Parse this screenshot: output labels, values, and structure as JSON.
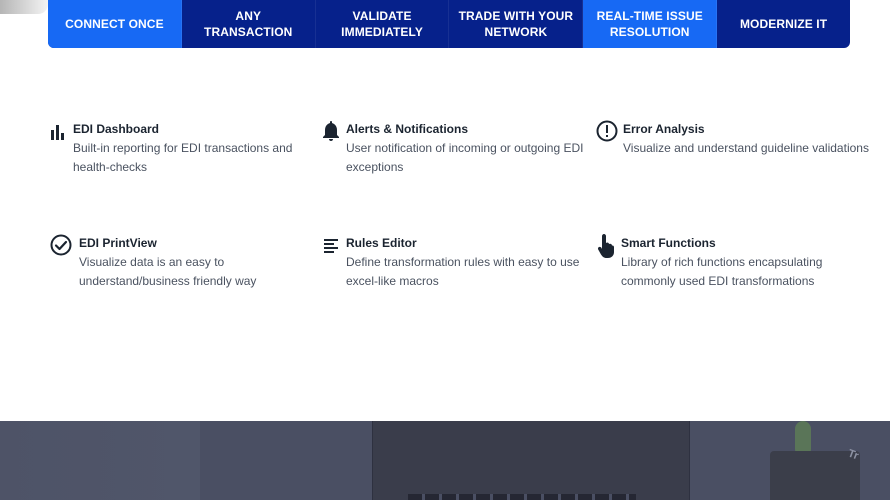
{
  "tabs": [
    {
      "label": "CONNECT ONCE",
      "active": true
    },
    {
      "label": "ANY TRANSACTION",
      "active": false
    },
    {
      "label": "VALIDATE IMMEDIATELY",
      "active": false
    },
    {
      "label": "TRADE WITH YOUR NETWORK",
      "active": false
    },
    {
      "label": "REAL-TIME ISSUE RESOLUTION",
      "active": true
    },
    {
      "label": "MODERNIZE IT",
      "active": false
    }
  ],
  "features": [
    {
      "icon": "bar-chart-icon",
      "title": "EDI Dashboard",
      "desc_line1": "Built-in reporting for EDI transactions and",
      "desc_line2": "health-checks"
    },
    {
      "icon": "bell-icon",
      "title": "Alerts & Notifications",
      "desc_line1": "User notification of incoming or outgoing EDI",
      "desc_line2": "exceptions"
    },
    {
      "icon": "exclamation-circle-icon",
      "title": "Error Analysis",
      "desc_line1": "Visualize and understand guideline validations",
      "desc_line2": ""
    },
    {
      "icon": "check-circle-icon",
      "title": "EDI PrintView",
      "desc_line1": "Visualize data is an easy to",
      "desc_line2": "understand/business friendly way"
    },
    {
      "icon": "text-lines-icon",
      "title": "Rules Editor",
      "desc_line1": "Define transformation rules with easy to use",
      "desc_line2": "excel-like macros"
    },
    {
      "icon": "hand-pointer-icon",
      "title": "Smart Functions",
      "desc_line1": "Library of rich functions encapsulating",
      "desc_line2": "commonly used EDI transformations"
    }
  ],
  "colors": {
    "tab_bg": "#06218b",
    "tab_active": "#1769f4",
    "band_bg": "#4a4f63"
  },
  "bottom_band": {
    "partial_label": "Tr"
  }
}
